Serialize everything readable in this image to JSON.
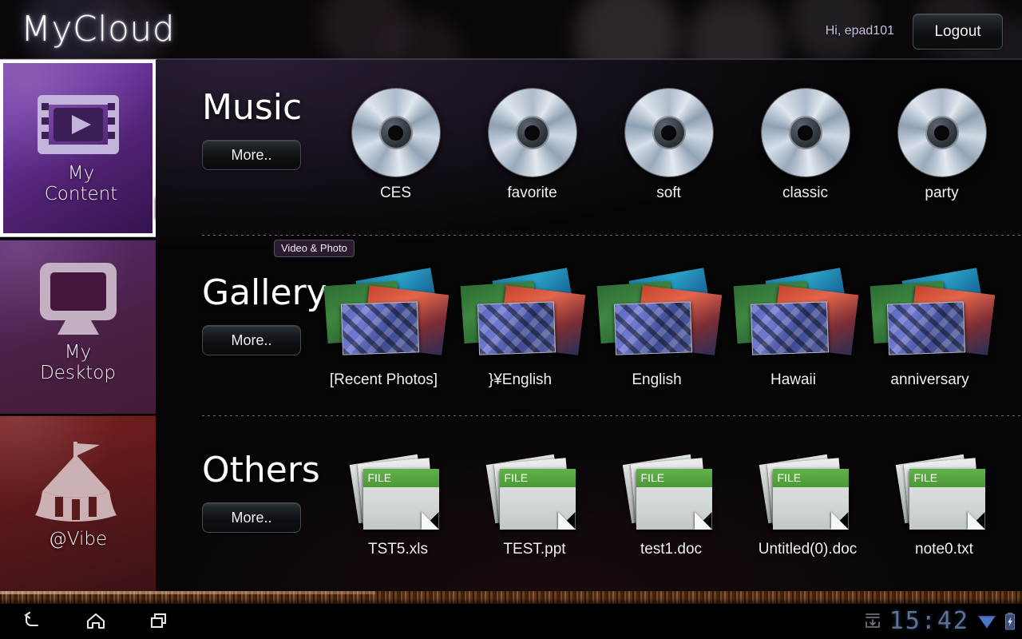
{
  "header": {
    "logo": "MyCloud",
    "greeting": "Hi, epad101",
    "logout_label": "Logout"
  },
  "sidebar": {
    "items": [
      {
        "id": "my-content",
        "label_line1": "My",
        "label_line2": "Content",
        "icon": "film-play-icon",
        "selected": true
      },
      {
        "id": "my-desktop",
        "label_line1": "My",
        "label_line2": "Desktop",
        "icon": "monitor-icon",
        "selected": false
      },
      {
        "id": "at-vibe",
        "label_line1": "@Vibe",
        "label_line2": "",
        "icon": "tent-icon",
        "selected": false
      }
    ]
  },
  "main": {
    "rows": [
      {
        "id": "music",
        "title": "Music",
        "badge": "",
        "more_label": "More..",
        "icon": "cd-icon",
        "tiles": [
          {
            "label": "CES"
          },
          {
            "label": "favorite"
          },
          {
            "label": "soft"
          },
          {
            "label": "classic"
          },
          {
            "label": "party"
          }
        ]
      },
      {
        "id": "gallery",
        "title": "Gallery",
        "badge": "Video & Photo",
        "more_label": "More..",
        "icon": "photo-stack-icon",
        "tiles": [
          {
            "label": "[Recent Photos]"
          },
          {
            "label": "}¥English"
          },
          {
            "label": "English"
          },
          {
            "label": "Hawaii"
          },
          {
            "label": "anniversary"
          }
        ]
      },
      {
        "id": "others",
        "title": "Others",
        "badge": "",
        "more_label": "More..",
        "icon": "file-icon",
        "file_band_label": "FILE",
        "tiles": [
          {
            "label": "TST5.xls"
          },
          {
            "label": "TEST.ppt"
          },
          {
            "label": "test1.doc"
          },
          {
            "label": "Untitled(0).doc"
          },
          {
            "label": "note0.txt"
          }
        ]
      }
    ]
  },
  "navbar": {
    "back_icon": "back-arrow-icon",
    "home_icon": "home-icon",
    "recents_icon": "recent-apps-icon",
    "status": {
      "download_icon": "download-icon",
      "clock": "15:42",
      "wifi_icon": "wifi-icon",
      "battery_icon": "battery-charging-icon"
    }
  },
  "colors": {
    "accent_purple": "#6c35a0",
    "accent_red": "#6c1c1c",
    "file_band_green": "#4c9a36",
    "clock_blue": "#5f7391"
  }
}
